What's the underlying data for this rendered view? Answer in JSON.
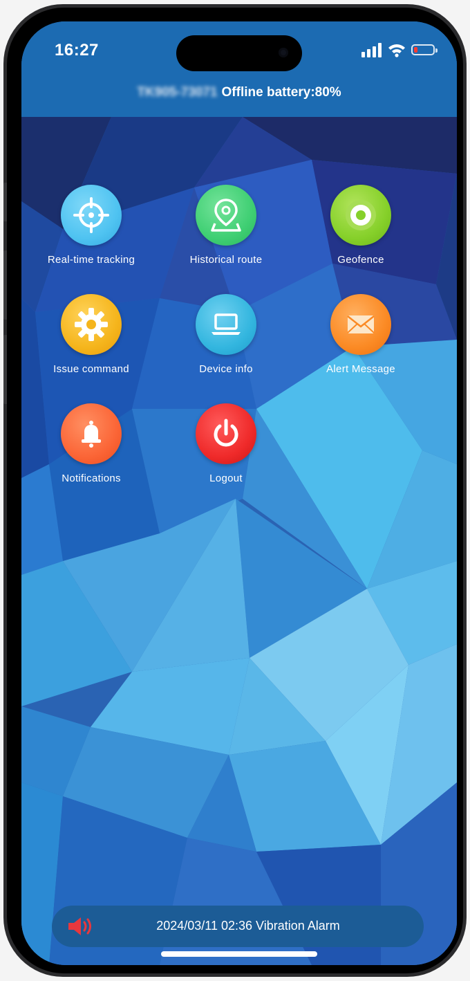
{
  "status_bar": {
    "time": "16:27",
    "signal_icon": "signal-bars-icon",
    "wifi_icon": "wifi-icon",
    "battery_icon": "battery-low-icon",
    "battery_color": "#ff3b30"
  },
  "header": {
    "device_id_blurred": "TK905-73071",
    "status_text": "Offline battery:80%"
  },
  "menu": {
    "items": [
      {
        "label": "Real-time tracking",
        "icon": "crosshair-icon",
        "color": "#4fc3f1"
      },
      {
        "label": "Historical route",
        "icon": "map-pin-icon",
        "color": "#3fcf73"
      },
      {
        "label": "Geofence",
        "icon": "target-circle-icon",
        "color": "#86d02a"
      },
      {
        "label": "Issue command",
        "icon": "gear-icon",
        "color": "#f5b51c"
      },
      {
        "label": "Device info",
        "icon": "laptop-icon",
        "color": "#33b6df"
      },
      {
        "label": "Alert Message",
        "icon": "envelope-icon",
        "color": "#fb8a24"
      },
      {
        "label": "Notifications",
        "icon": "bell-icon",
        "color": "#fb6536"
      },
      {
        "label": "Logout",
        "icon": "power-icon",
        "color": "#ef2a2a"
      }
    ]
  },
  "alarm": {
    "icon": "speaker-alarm-icon",
    "text": "2024/03/11 02:36 Vibration Alarm"
  }
}
